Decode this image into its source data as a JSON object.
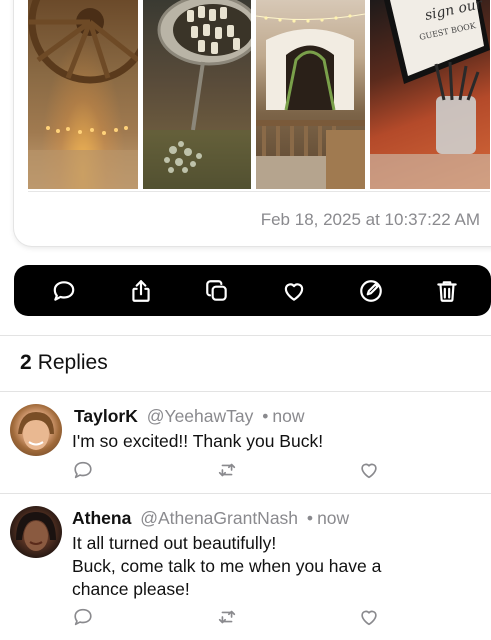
{
  "post": {
    "timestamp": "Feb 18, 2025 at 10:37:22 AM",
    "photos": [
      "wagon-wheel-photo",
      "bottles-in-cart-photo",
      "barn-venue-photo",
      "guestbook-sign-photo"
    ]
  },
  "actions": [
    {
      "icon": "comment-icon"
    },
    {
      "icon": "share-icon"
    },
    {
      "icon": "copy-icon"
    },
    {
      "icon": "heart-icon"
    },
    {
      "icon": "edit-icon"
    },
    {
      "icon": "trash-icon"
    }
  ],
  "replies": {
    "count": "2",
    "label": "Replies",
    "items": [
      {
        "name": "TaylorK",
        "handle": "@YeehawTay",
        "separator": "•",
        "time": "now",
        "text": "I'm so excited!! Thank you Buck!"
      },
      {
        "name": "Athena",
        "handle": "@AthenaGrantNash",
        "separator": "•",
        "time": "now",
        "text_line1": "It all turned out beautifully!",
        "text_line2": "Buck, come talk to me when you have a",
        "text_line3": "chance please!"
      }
    ]
  },
  "colors": {
    "action_bar": "#000000",
    "secondary_text": "#8a8a8e",
    "divider": "#e3e3e3"
  }
}
